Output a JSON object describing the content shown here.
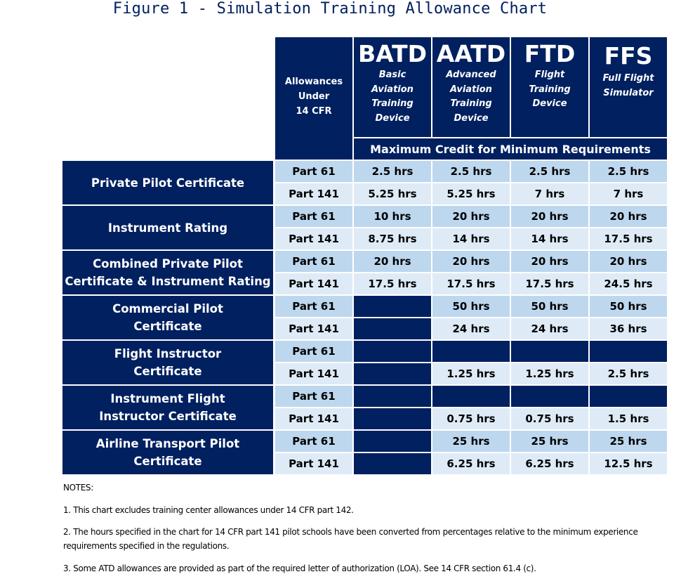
{
  "title": "Figure 1 - Simulation Training Allowance Chart",
  "colors": {
    "navy": "#002060",
    "part61_row": "#BDD7EE",
    "part141_row": "#DEEBF7",
    "title_text": "#002060"
  },
  "header": {
    "allowances_label": [
      "Allowances",
      "Under",
      "14 CFR"
    ],
    "devices": [
      {
        "abbr": "BATD",
        "full": [
          "Basic",
          "Aviation",
          "Training",
          "Device"
        ]
      },
      {
        "abbr": "AATD",
        "full": [
          "Advanced",
          "Aviation",
          "Training",
          "Device"
        ]
      },
      {
        "abbr": "FTD",
        "full": [
          "Flight",
          "Training",
          "Device"
        ]
      },
      {
        "abbr": "FFS",
        "full": [
          "Full Flight",
          "Simulator"
        ]
      }
    ],
    "max_credit": "Maximum Credit for Minimum Requirements"
  },
  "groups": [
    {
      "label": [
        "Private Pilot Certificate"
      ],
      "rows": [
        {
          "part": "Part 61",
          "values": [
            "2.5 hrs",
            "2.5 hrs",
            "2.5 hrs",
            "2.5 hrs"
          ]
        },
        {
          "part": "Part 141",
          "values": [
            "5.25 hrs",
            "5.25 hrs",
            "7 hrs",
            "7 hrs"
          ]
        }
      ]
    },
    {
      "label": [
        "Instrument Rating"
      ],
      "rows": [
        {
          "part": "Part 61",
          "values": [
            "10 hrs",
            "20 hrs",
            "20 hrs",
            "20 hrs"
          ]
        },
        {
          "part": "Part 141",
          "values": [
            "8.75 hrs",
            "14 hrs",
            "14 hrs",
            "17.5 hrs"
          ]
        }
      ]
    },
    {
      "label": [
        "Combined Private Pilot",
        "Certificate & Instrument Rating"
      ],
      "rows": [
        {
          "part": "Part 61",
          "values": [
            "20 hrs",
            "20 hrs",
            "20 hrs",
            "20 hrs"
          ]
        },
        {
          "part": "Part 141",
          "values": [
            "17.5 hrs",
            "17.5 hrs",
            "17.5 hrs",
            "24.5 hrs"
          ]
        }
      ]
    },
    {
      "label": [
        "Commercial Pilot",
        "Certificate"
      ],
      "rows": [
        {
          "part": "Part 61",
          "values": [
            null,
            "50 hrs",
            "50 hrs",
            "50 hrs"
          ]
        },
        {
          "part": "Part 141",
          "values": [
            null,
            "24 hrs",
            "24 hrs",
            "36 hrs"
          ]
        }
      ]
    },
    {
      "label": [
        "Flight Instructor",
        "Certificate"
      ],
      "rows": [
        {
          "part": "Part 61",
          "values": [
            null,
            null,
            null,
            null
          ]
        },
        {
          "part": "Part 141",
          "values": [
            null,
            "1.25 hrs",
            "1.25 hrs",
            "2.5 hrs"
          ]
        }
      ]
    },
    {
      "label": [
        "Instrument Flight",
        "Instructor Certificate"
      ],
      "rows": [
        {
          "part": "Part 61",
          "values": [
            null,
            null,
            null,
            null
          ]
        },
        {
          "part": "Part 141",
          "values": [
            null,
            "0.75 hrs",
            "0.75 hrs",
            "1.5 hrs"
          ]
        }
      ]
    },
    {
      "label": [
        "Airline Transport Pilot",
        "Certificate"
      ],
      "rows": [
        {
          "part": "Part 61",
          "values": [
            null,
            "25 hrs",
            "25 hrs",
            "25 hrs"
          ]
        },
        {
          "part": "Part 141",
          "values": [
            null,
            "6.25 hrs",
            "6.25 hrs",
            "12.5 hrs"
          ]
        }
      ]
    }
  ],
  "notes": {
    "heading": "NOTES:",
    "items": [
      "1. This chart excludes training center allowances under 14 CFR part 142.",
      "2. The hours specified in the chart for 14 CFR part 141 pilot schools have been converted from percentages relative to the minimum experience requirements specified in the regulations.",
      "3. Some ATD allowances are provided as part of the required letter of authorization (LOA). See 14 CFR section 61.4 (c)."
    ]
  }
}
